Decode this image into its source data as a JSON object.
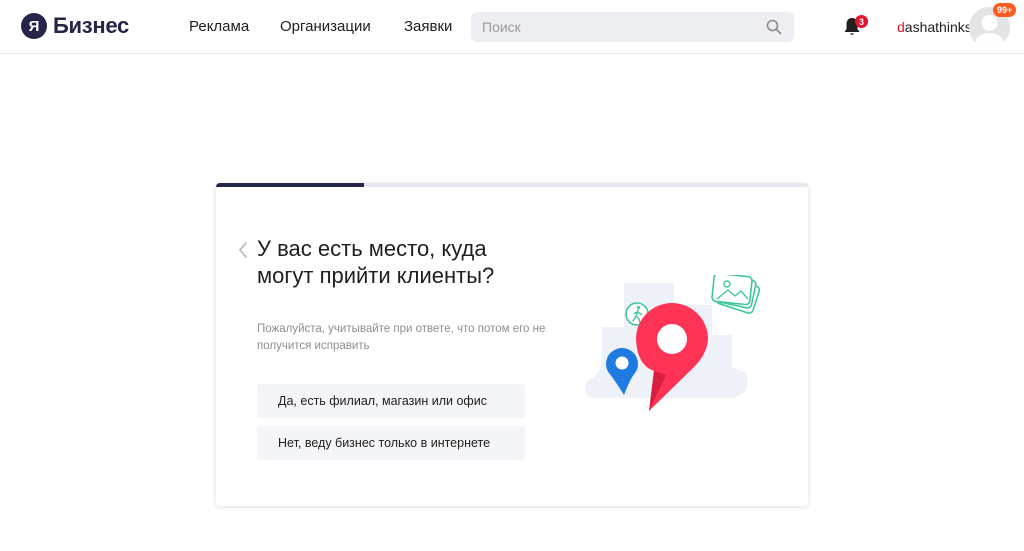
{
  "header": {
    "logo_letter": "Я",
    "logo_text": "Бизнес",
    "nav": {
      "ads": "Реклама",
      "orgs": "Организации",
      "requests": "Заявки"
    },
    "search": {
      "placeholder": "Поиск",
      "value": ""
    },
    "notifications_count": "3",
    "user": {
      "first_letter": "d",
      "rest": "ashathinks"
    },
    "avatar_badge": "99+"
  },
  "question": {
    "title": "У вас есть место, куда могут прийти клиенты?",
    "hint": "Пожалуйста, учитывайте при ответе, что потом его не получится исправить",
    "progress": 0.25,
    "options": [
      {
        "label": "Да, есть филиал, магазин или офис"
      },
      {
        "label": "Нет, веду бизнес только в интернете"
      }
    ]
  },
  "colors": {
    "brand": "#25254a",
    "accent_red": "#ff3355",
    "pin_blue": "#1e7be0",
    "green_lines": "#3fc89a"
  }
}
